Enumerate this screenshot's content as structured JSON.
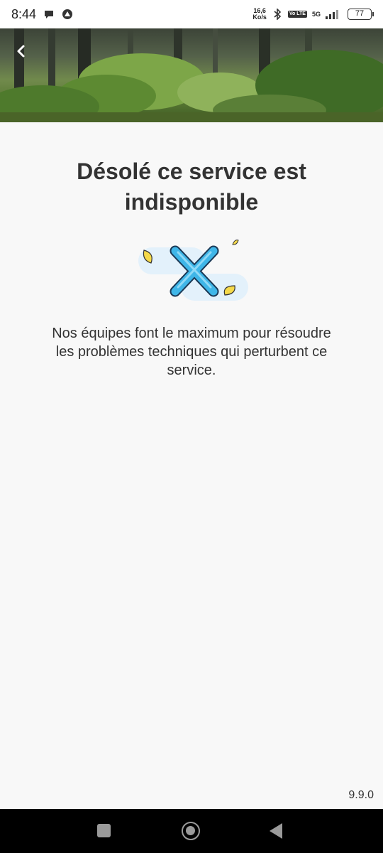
{
  "status_bar": {
    "time": "8:44",
    "net_speed_value": "16,6",
    "net_speed_unit": "Ko/s",
    "volte": "Vo LTE",
    "network": "5G",
    "battery": "77"
  },
  "header": {
    "back_icon": "chevron-left-icon"
  },
  "main": {
    "title": "Désolé ce service est indisponible",
    "illustration_icon": "error-x-icon",
    "message": "Nos équipes font le maximum pour résoudre les problèmes techniques qui perturbent ce service.",
    "version": "9.9.0"
  },
  "colors": {
    "accent_blue": "#3fb6e8",
    "bubble_blue": "#e3f1fb",
    "leaf_yellow": "#f5d94a"
  }
}
